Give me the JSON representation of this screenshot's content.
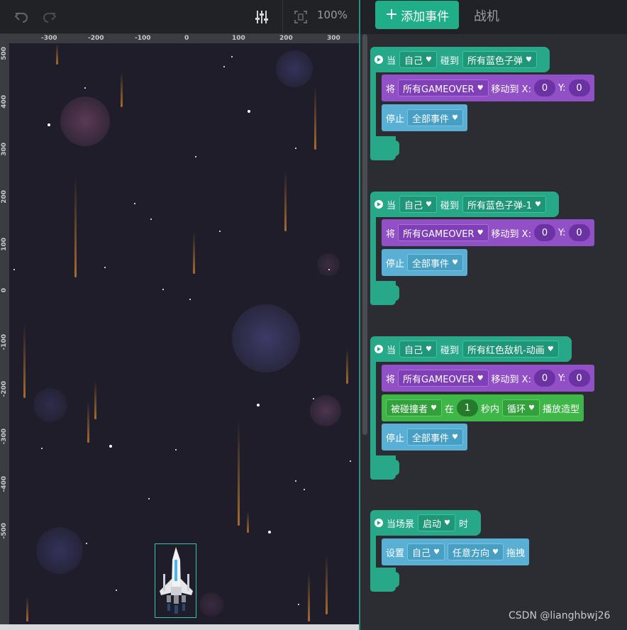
{
  "toolbar": {
    "undo_icon": "undo-icon",
    "redo_icon": "redo-icon",
    "settings_icon": "sliders-icon",
    "fit_icon": "fit-screen-icon",
    "zoom": "100%"
  },
  "ruler": {
    "x_ticks": [
      "-300",
      "-200",
      "-100",
      "0",
      "100",
      "200",
      "300"
    ],
    "y_ticks": [
      "500",
      "400",
      "300",
      "200",
      "100",
      "0",
      "-100",
      "-200",
      "-300",
      "-400",
      "-500"
    ]
  },
  "header": {
    "add_event_label": "添加事件",
    "sprite_name": "战机"
  },
  "scripts": [
    {
      "hat": {
        "prefix": "当",
        "subject": "自己",
        "verb": "碰到",
        "target": "所有蓝色子弹"
      },
      "blocks": [
        {
          "kind": "move",
          "label": "将",
          "target": "所有GAMEOVER",
          "verb": "移动到 X:",
          "x": "0",
          "ylabel": "Y:",
          "y": "0"
        },
        {
          "kind": "stop",
          "label": "停止",
          "target": "全部事件"
        }
      ]
    },
    {
      "hat": {
        "prefix": "当",
        "subject": "自己",
        "verb": "碰到",
        "target": "所有蓝色子弹-1"
      },
      "blocks": [
        {
          "kind": "move",
          "label": "将",
          "target": "所有GAMEOVER",
          "verb": "移动到 X:",
          "x": "0",
          "ylabel": "Y:",
          "y": "0"
        },
        {
          "kind": "stop",
          "label": "停止",
          "target": "全部事件"
        }
      ]
    },
    {
      "hat": {
        "prefix": "当",
        "subject": "自己",
        "verb": "碰到",
        "target": "所有红色敌机-动画"
      },
      "blocks": [
        {
          "kind": "move",
          "label": "将",
          "target": "所有GAMEOVER",
          "verb": "移动到 X:",
          "x": "0",
          "ylabel": "Y:",
          "y": "0"
        },
        {
          "kind": "anim",
          "target": "被碰撞者",
          "in": "在",
          "secs": "1",
          "unit": "秒内",
          "mode": "循环",
          "action": "播放造型"
        },
        {
          "kind": "stop",
          "label": "停止",
          "target": "全部事件"
        }
      ]
    },
    {
      "hat": {
        "prefix": "当场景",
        "event": "启动",
        "suffix": "时"
      },
      "blocks": [
        {
          "kind": "drag",
          "label": "设置",
          "target": "自己",
          "dir": "任意方向",
          "action": "拖拽"
        }
      ]
    }
  ],
  "watermark": "CSDN @lianghbwj26",
  "colors": {
    "event_green": "#27a889",
    "motion_purple": "#9150c6",
    "control_blue": "#5ab0d4",
    "looks_green": "#3fb648",
    "stage_bg": "#1e1d29",
    "accent": "#1fae88"
  }
}
